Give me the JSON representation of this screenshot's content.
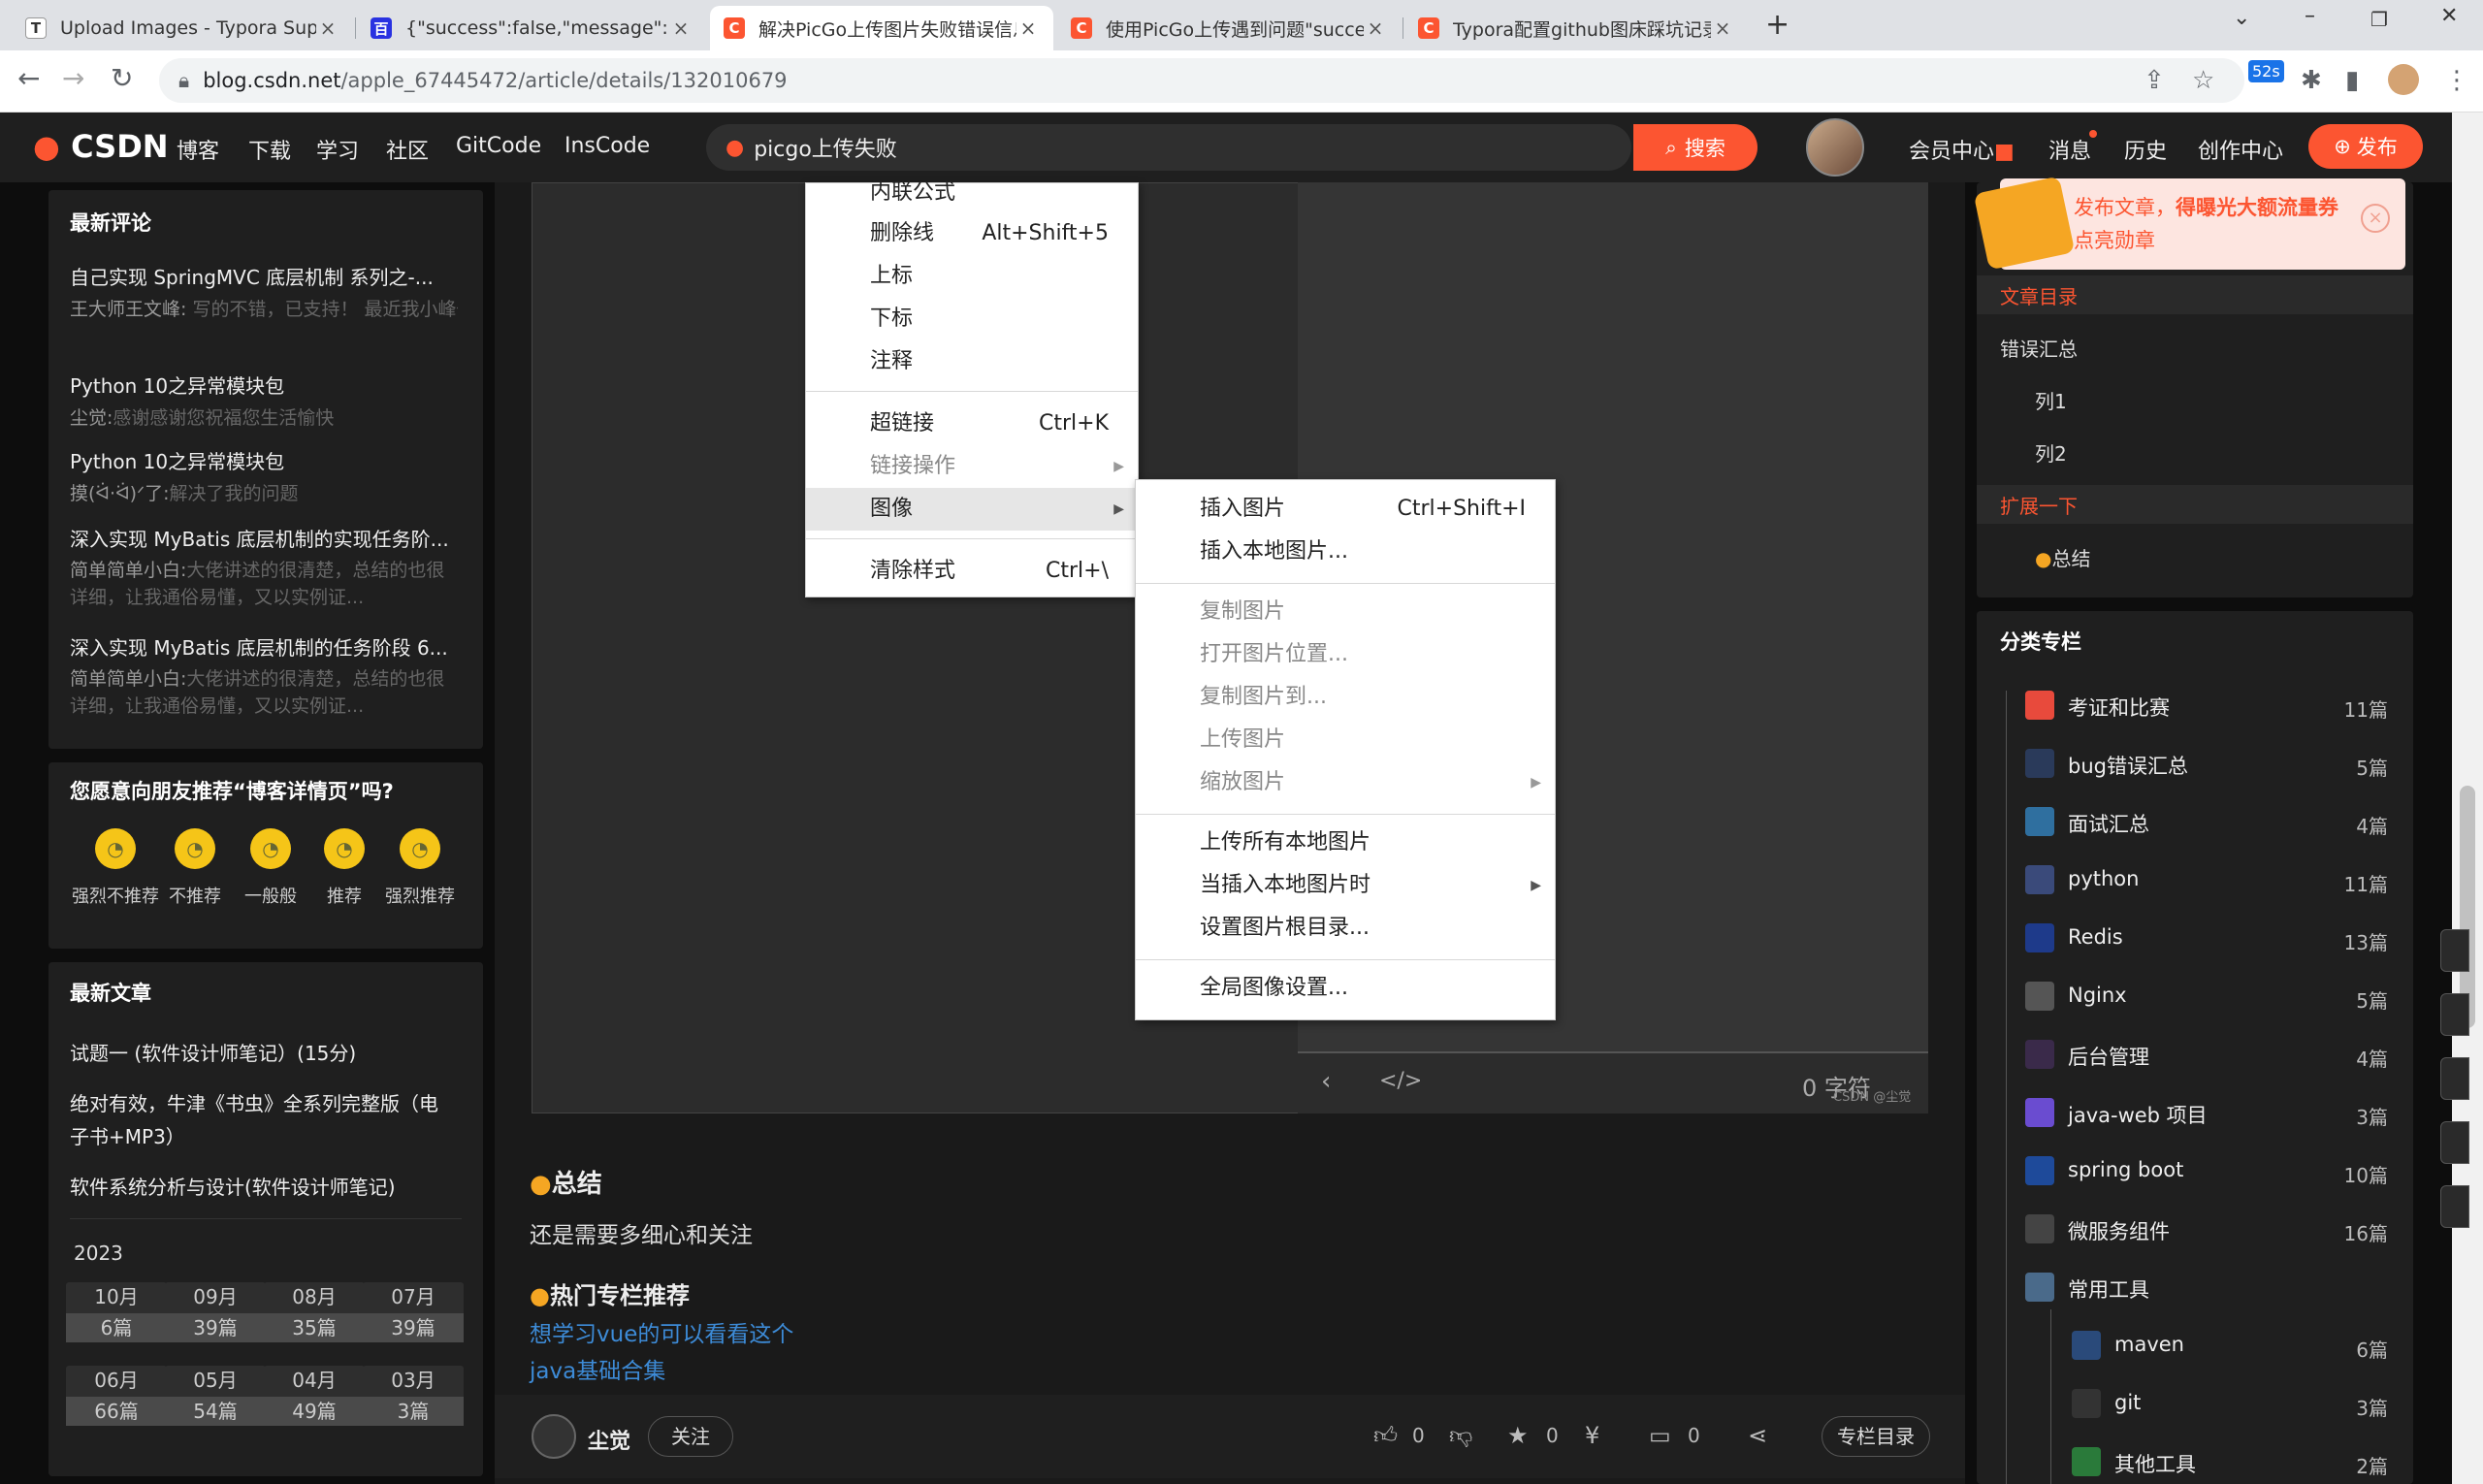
{
  "browser": {
    "tabs": [
      {
        "title": "Upload Images - Typora Supp",
        "favicon": "T",
        "color": "#5f6368"
      },
      {
        "title": "{\"success\":false,\"message\":\"up",
        "favicon": "百",
        "color": "#2932e1"
      },
      {
        "title": "解决PicGo上传图片失败错误信息",
        "favicon": "C",
        "color": "#fc5531"
      },
      {
        "title": "使用PicGo上传遇到问题\"succes",
        "favicon": "C",
        "color": "#fc5531"
      },
      {
        "title": "Typora配置github图床踩坑记录",
        "favicon": "C",
        "color": "#fc5531"
      }
    ],
    "url_host": "blog.csdn.net",
    "url_path": "/apple_67445472/article/details/132010679",
    "ext_badge": "52s"
  },
  "csdn": {
    "logo": "CSDN",
    "nav": [
      "博客",
      "下载",
      "学习",
      "社区",
      "GitCode",
      "InsCode"
    ],
    "search_value": "picgo上传失败",
    "search_button": "搜索",
    "right_links": [
      "会员中心",
      "消息",
      "历史",
      "创作中心"
    ],
    "publish": "发布"
  },
  "left": {
    "comments_title": "最新评论",
    "comments": [
      {
        "title": "自己实现 SpringMVC 底层机制 系列之-...",
        "user": "王大师王文峰:",
        "text": "写的不错，已支持！ 最近我小峰也在写博客,有空来看看我呀，·..."
      },
      {
        "title": "Python 10之异常模块包",
        "user": "尘觉:",
        "text": "感谢感谢您祝福您生活愉快"
      },
      {
        "title": "Python 10之异常模块包",
        "user": "摸(ᐛ·ᐛ)ᐟ了:",
        "text": "解决了我的问题"
      },
      {
        "title": "深入实现 MyBatis 底层机制的实现任务阶...",
        "user": "简单简单小白:",
        "text": "大佬讲述的很清楚，总结的也很详细，让我通俗易懂，又以实例证..."
      },
      {
        "title": "深入实现 MyBatis 底层机制的任务阶段 6...",
        "user": "简单简单小白:",
        "text": "大佬讲述的很清楚，总结的也很详细，让我通俗易懂，又以实例证..."
      }
    ],
    "recommend_title": "您愿意向朋友推荐“博客详情页”吗?",
    "ratings": [
      "强烈不推荐",
      "不推荐",
      "一般般",
      "推荐",
      "强烈推荐"
    ],
    "latest_title": "最新文章",
    "latest": [
      "试题一 (软件设计师笔记）(15分)",
      "绝对有效，牛津《书虫》全系列完整版（电",
      "子书+MP3）",
      "软件系统分析与设计(软件设计师笔记)"
    ],
    "year": "2023",
    "months": [
      {
        "m": "10月",
        "c": "6篇"
      },
      {
        "m": "09月",
        "c": "39篇"
      },
      {
        "m": "08月",
        "c": "35篇"
      },
      {
        "m": "07月",
        "c": "39篇"
      },
      {
        "m": "06月",
        "c": "66篇"
      },
      {
        "m": "05月",
        "c": "54篇"
      },
      {
        "m": "04月",
        "c": "49篇"
      },
      {
        "m": "03月",
        "c": "3篇"
      }
    ]
  },
  "menu1": [
    {
      "label": "内联公式",
      "sc": ""
    },
    {
      "label": "删除线",
      "sc": "Alt+Shift+5"
    },
    {
      "label": "上标",
      "sc": ""
    },
    {
      "label": "下标",
      "sc": ""
    },
    {
      "label": "注释",
      "sc": ""
    },
    {
      "label": "超链接",
      "sc": "Ctrl+K"
    },
    {
      "label": "链接操作",
      "sc": ""
    },
    {
      "label": "图像",
      "sc": ""
    },
    {
      "label": "清除样式",
      "sc": "Ctrl+\\"
    }
  ],
  "menu2": [
    {
      "label": "插入图片",
      "sc": "Ctrl+Shift+I"
    },
    {
      "label": "插入本地图片...",
      "sc": ""
    },
    {
      "label": "复制图片",
      "sc": ""
    },
    {
      "label": "打开图片位置...",
      "sc": ""
    },
    {
      "label": "复制图片到...",
      "sc": ""
    },
    {
      "label": "上传图片",
      "sc": ""
    },
    {
      "label": "缩放图片",
      "sc": ""
    },
    {
      "label": "上传所有本地图片",
      "sc": ""
    },
    {
      "label": "当插入本地图片时",
      "sc": ""
    },
    {
      "label": "设置图片根目录...",
      "sc": ""
    },
    {
      "label": "全局图像设置...",
      "sc": ""
    }
  ],
  "editor": {
    "word_count": "0 字符",
    "watermark": "CSDN @尘觉"
  },
  "article": {
    "summary_heading": "总结",
    "summary_text": "还是需要多细心和关注",
    "hot_heading": "热门专栏推荐",
    "links": [
      "想学习vue的可以看看这个",
      "java基础合集"
    ]
  },
  "bottom": {
    "author": "尘觉",
    "follow": "关注",
    "like": "0",
    "collect": "0",
    "comment": "0",
    "catalog": "专栏目录"
  },
  "right": {
    "promo_line1": "发布文章，",
    "promo_line1b": "得曝光大额流量券",
    "promo_line2": "点亮勋章",
    "toc_title": "文章目录",
    "toc": [
      "错误汇总",
      "列1",
      "列2",
      "扩展一下",
      "总结"
    ],
    "cat_title": "分类专栏",
    "cats": [
      {
        "name": "考证和比赛",
        "count": "11篇",
        "color": "#e84a3c"
      },
      {
        "name": "bug错误汇总",
        "count": "5篇",
        "color": "#2a3a5a"
      },
      {
        "name": "面试汇总",
        "count": "4篇",
        "color": "#2f6f9f"
      },
      {
        "name": "python",
        "count": "11篇",
        "color": "#3a4a7a"
      },
      {
        "name": "Redis",
        "count": "13篇",
        "color": "#1e3a8a"
      },
      {
        "name": "Nginx",
        "count": "5篇",
        "color": "#555"
      },
      {
        "name": "后台管理",
        "count": "4篇",
        "color": "#3a2a4a"
      },
      {
        "name": "java-web 项目",
        "count": "3篇",
        "color": "#6a4cd0"
      },
      {
        "name": "spring boot",
        "count": "10篇",
        "color": "#1e4a9a"
      },
      {
        "name": "微服务组件",
        "count": "16篇",
        "color": "#444"
      },
      {
        "name": "常用工具",
        "count": "",
        "color": "#4a6a8a"
      },
      {
        "name": "maven",
        "count": "6篇",
        "color": "#2a4a7a"
      },
      {
        "name": "git",
        "count": "3篇",
        "color": "#333"
      },
      {
        "name": "其他工具",
        "count": "2篇",
        "color": "#2a7a3a"
      }
    ]
  }
}
